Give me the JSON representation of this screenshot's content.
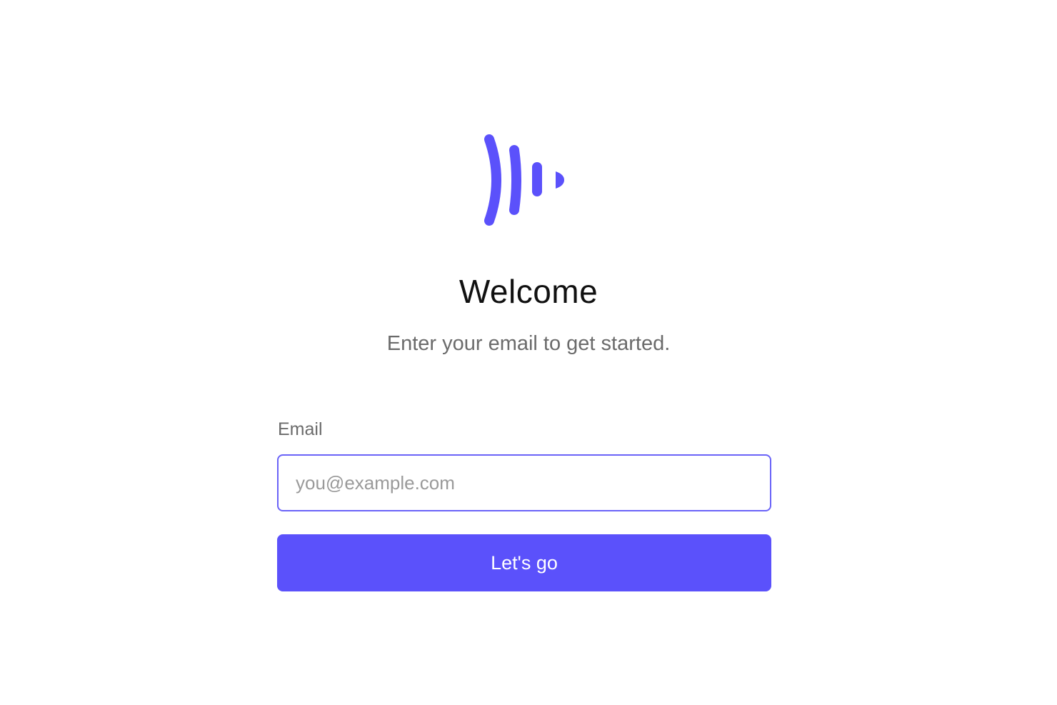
{
  "brand": {
    "logo_icon": "sound-wave-logo-icon",
    "accent_color": "#5b51fb"
  },
  "header": {
    "title": "Welcome",
    "subtitle": "Enter your email to get started."
  },
  "form": {
    "email_label": "Email",
    "email_placeholder": "you@example.com",
    "email_value": "",
    "submit_label": "Let's go"
  }
}
